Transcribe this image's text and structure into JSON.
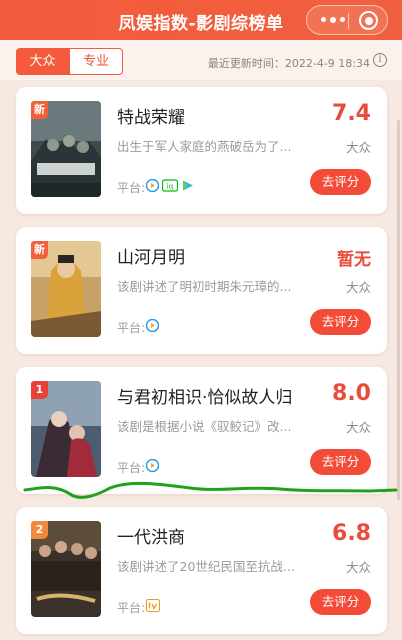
{
  "header": {
    "title": "凤娱指数-影剧综榜单"
  },
  "tabs": [
    {
      "label": "大众",
      "active": true
    },
    {
      "label": "专业",
      "active": false
    }
  ],
  "updated": "最近更新时间：2022-4-9 18:34",
  "platform_label": "平台:",
  "rate_label": "去评分",
  "cards": [
    {
      "badge": "新",
      "name": "特战荣耀",
      "desc": "出生于军人家庭的燕破岳为了...",
      "score": "7.4",
      "audience": "大众",
      "platforms": [
        "tencent-video-icon",
        "iqiyi-icon",
        "youku-icon"
      ]
    },
    {
      "badge": "新",
      "name": "山河月明",
      "desc": "该剧讲述了明初时期朱元璋的...",
      "score": "暂无",
      "audience": "大众",
      "platforms": [
        "tencent-video-icon"
      ]
    },
    {
      "badge": "1",
      "name": "与君初相识·恰似故人归",
      "desc": "该剧是根据小说《驭鲛记》改...",
      "score": "8.0",
      "audience": "大众",
      "platforms": [
        "tencent-video-icon"
      ]
    },
    {
      "badge": "2",
      "name": "一代洪商",
      "desc": "该剧讲述了20世纪民国至抗战...",
      "score": "6.8",
      "audience": "大众",
      "platforms": [
        "mango-tv-icon"
      ]
    }
  ],
  "colors": {
    "accent": "#f45a3c",
    "score": "#e84c3a",
    "annotation": "#1fa21a"
  }
}
